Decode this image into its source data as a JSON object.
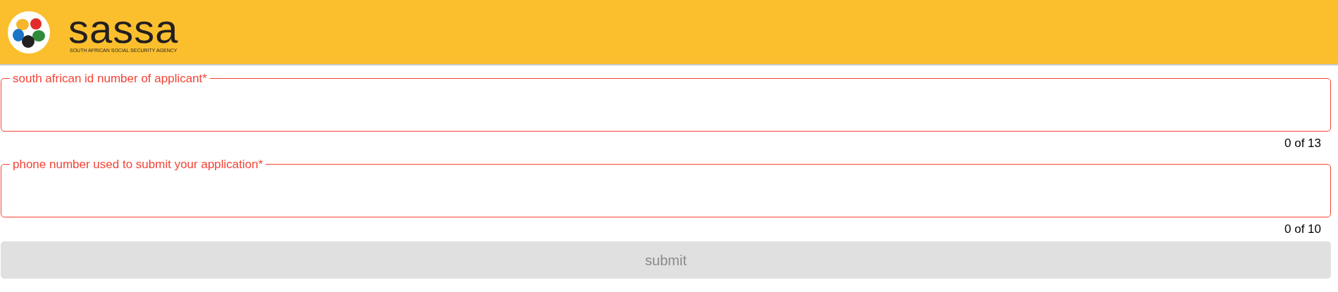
{
  "header": {
    "brand": "sassa",
    "tagline": "SOUTH AFRICAN SOCIAL SECURITY AGENCY"
  },
  "fields": [
    {
      "label": "south african id number of applicant*",
      "counter": "0 of 13",
      "error": true
    },
    {
      "label": "phone number used to submit your application*",
      "counter": "0 of 10",
      "error": true
    }
  ],
  "submit": {
    "label": "submit",
    "disabled": true
  }
}
